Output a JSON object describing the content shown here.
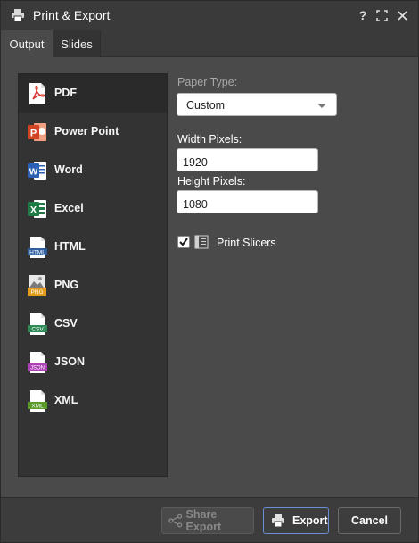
{
  "window": {
    "title": "Print & Export",
    "help_icon": "help-icon",
    "maximize_icon": "maximize-icon",
    "close_icon": "close-icon"
  },
  "tabs": [
    {
      "label": "Output",
      "active": true
    },
    {
      "label": "Slides",
      "active": false
    }
  ],
  "formats": [
    {
      "label": "PDF",
      "icon": "pdf-icon",
      "selected": true
    },
    {
      "label": "Power Point",
      "icon": "powerpoint-icon",
      "selected": false
    },
    {
      "label": "Word",
      "icon": "word-icon",
      "selected": false
    },
    {
      "label": "Excel",
      "icon": "excel-icon",
      "selected": false
    },
    {
      "label": "HTML",
      "icon": "html-icon",
      "selected": false
    },
    {
      "label": "PNG",
      "icon": "png-icon",
      "selected": false
    },
    {
      "label": "CSV",
      "icon": "csv-icon",
      "selected": false
    },
    {
      "label": "JSON",
      "icon": "json-icon",
      "selected": false
    },
    {
      "label": "XML",
      "icon": "xml-icon",
      "selected": false
    }
  ],
  "settings": {
    "paper_type_label": "Paper Type:",
    "paper_type_value": "Custom",
    "width_label": "Width Pixels:",
    "width_value": "1920",
    "height_label": "Height Pixels:",
    "height_value": "1080",
    "print_slicers_label": "Print Slicers",
    "print_slicers_checked": true
  },
  "footer": {
    "share_export_label": "Share Export",
    "export_label": "Export",
    "cancel_label": "Cancel"
  },
  "colors": {
    "accent_border": "#6b8fd6",
    "pdf": "#d9342b",
    "powerpoint": "#d04423",
    "word": "#2b5fb4",
    "excel": "#1f7a45",
    "html": "#2f5f9e",
    "png": "#e49b18",
    "csv": "#2e8b57",
    "json": "#b040b8",
    "xml": "#5a9a2a"
  }
}
